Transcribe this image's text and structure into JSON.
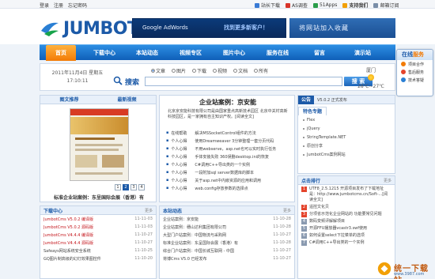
{
  "top": {
    "left_links": [
      "登录",
      "注册",
      "忘记密码"
    ],
    "right_links": [
      "站长下载",
      "AS调查",
      "51Apps",
      "支持我们",
      "邮箱订阅"
    ]
  },
  "brand": {
    "logo_text": "JUMBOT",
    "ad1_text": "Google AdWords",
    "ad1_cn": "找到更多新客户！",
    "ad2_text": "将网站加入收藏"
  },
  "nav": {
    "home": "首页",
    "items": [
      "下载中心",
      "本站动态",
      "视频专区",
      "图片中心",
      "服务在线",
      "留言",
      "演示站"
    ]
  },
  "search": {
    "date": "2011年11月4日 星期五",
    "time": "17:10:11",
    "label": "搜索",
    "button": "搜 索",
    "radios": [
      "文章",
      "图片",
      "下载",
      "视频",
      "文档",
      "所有"
    ],
    "selected": "文章"
  },
  "weather": {
    "city": "厦门",
    "temp": "28℃~27℃"
  },
  "left": {
    "tab1": "图文推荐",
    "tab2": "最新视频",
    "pages": [
      "1",
      "2",
      "3",
      "4"
    ],
    "caption": "标准企业站案例：东呈国际会展（香港）有"
  },
  "mid": {
    "title": "企业站案例：京安能",
    "desc": "北京京安能科技有限公司是由国家重点高新技术园区 北京中关村高新科技园区，是一家拥有自主知识产权。[阅读全文]",
    "news": [
      {
        "b": "▪",
        "tag": "在线帮助",
        "tx": "解决MSSocketControl组件的方法"
      },
      {
        "b": "▪",
        "tag": "个人心得",
        "tx": "使用Dreamweaver 3分钟整理一套分页代码"
      },
      {
        "b": "▪",
        "tag": "个人心得",
        "tx": "不用webserve，asp.net也可以实时执行任务"
      },
      {
        "b": "▪",
        "tag": "个人心得",
        "tx": "手体安装失败 360误删desktop.ini的恢复"
      },
      {
        "b": "▪",
        "tag": "个人心得",
        "tx": "C#调用C++导出类的一个实例"
      },
      {
        "b": "▪",
        "tag": "个人心得",
        "tx": "一段附加sql server数据库的脚本"
      },
      {
        "b": "▪",
        "tag": "个人心得",
        "tx": "关于asp.net中内嵌资源的应用和调用"
      },
      {
        "b": "▪",
        "tag": "个人心得",
        "tx": "web.config存放参数的选择点"
      }
    ]
  },
  "right": {
    "notice_tag": "公告",
    "notice_text": "V5.0.2 正式发布",
    "tab_on": "特色专题",
    "tab_off": "",
    "items": [
      "Flex",
      "jQuery",
      "StringTemplate.NET",
      "原创分享",
      "JumbotCms案例网站"
    ],
    "rank_title": "点击排行",
    "rank_more": "更多",
    "rank": [
      {
        "n": "1",
        "tx": "UTF8_2.5.1215 开源项目发布了下载地址是：http://www.jumbotcms.cn/Soft-...[阅读全文]"
      },
      {
        "n": "2",
        "tx": "遥控文化贝"
      },
      {
        "n": "3",
        "tx": "分项省示范化企业网站的 功能要常见问题"
      },
      {
        "n": "4",
        "tx": "数码变频评解解项目"
      },
      {
        "n": "5",
        "tx": "开源FFU播放器vcastr3.swf使用"
      },
      {
        "n": "6",
        "tx": "如何设置select下拉菜单的选项"
      },
      {
        "n": "7",
        "tx": "C#调用C++导出类的一个实例"
      }
    ]
  },
  "downloads": {
    "title": "下载中心",
    "more": "更多",
    "rows": [
      {
        "tx": "JumbotCms V5.0.2 编译版",
        "dt": "11-11-03",
        "red": true
      },
      {
        "tx": "JumbotCms V5.0.2 源码版",
        "dt": "11-11-03",
        "red": true
      },
      {
        "tx": "JumbotCms V4.4.4 编译版",
        "dt": "11-10-27",
        "red": true
      },
      {
        "tx": "JumbotCms V4.4.4 源码版",
        "dt": "11-10-27",
        "red": true
      },
      {
        "tx": "Safeays网站系统安全系统",
        "dt": "11-10-25",
        "red": false
      },
      {
        "tx": "GQ图片制高级的幻灯效果图控件",
        "dt": "11-10-20",
        "red": false
      }
    ]
  },
  "site": {
    "title": "本站动态",
    "more": "更多",
    "rows": [
      {
        "tx": "企业站案例：京安能",
        "dt": "11-10-28"
      },
      {
        "tx": "企业站案例：穗山达利集团有限公司",
        "dt": "11-10-28"
      },
      {
        "tx": "大型门户站案例：中国物流与采购网",
        "dt": "11-10-27"
      },
      {
        "tx": "标准企业站案例：东呈国际会展（香港）有",
        "dt": "11-10-28"
      },
      {
        "tx": "综合门户站案例：中国长城互联网 - 中国",
        "dt": "11-10-27"
      },
      {
        "tx": "将博Cms V5.0 已经发布",
        "dt": "11-10-27"
      }
    ]
  },
  "float": {
    "title_a": "在线",
    "title_b": "服务",
    "items": [
      "项目合作",
      "售后服务",
      "技术答疑"
    ]
  },
  "watermark": {
    "t": "统一下载站",
    "u": "www.3987.com"
  },
  "colors": {
    "brand_blue": "#1c5aa8",
    "nav_orange": "#f27b06",
    "rank_red": "#e4442c"
  }
}
